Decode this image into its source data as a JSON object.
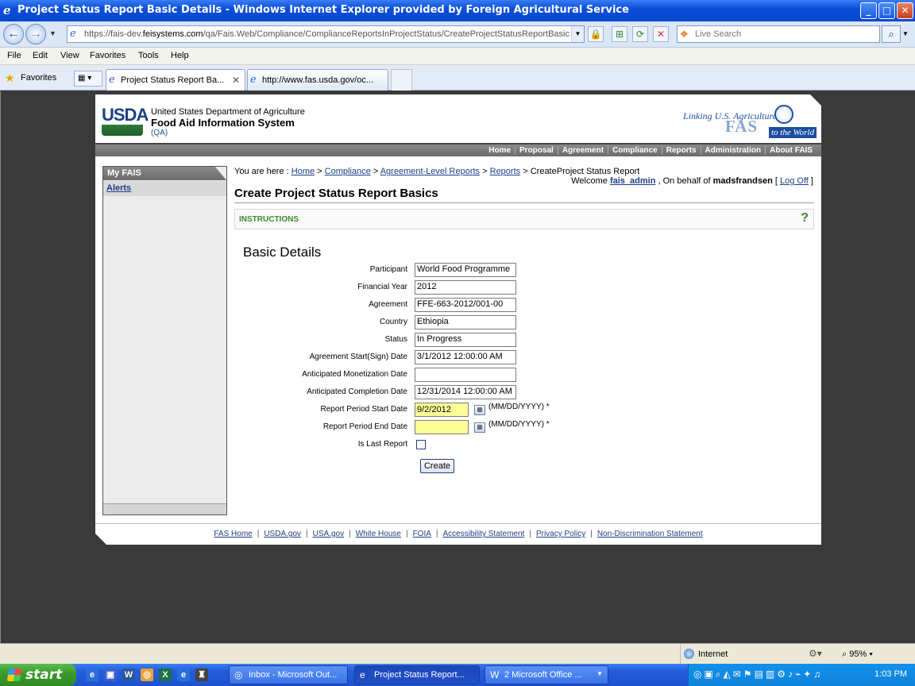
{
  "window": {
    "title": "Project Status Report Basic Details - Windows Internet Explorer provided by Foreign Agricultural Service",
    "minimize": "_",
    "maximize": "□",
    "close": "✕"
  },
  "addressbar": {
    "url_prefix": "https://fais-dev.",
    "url_host": "feisystems.com",
    "url_rest": "/qa/Fais.Web/Compliance/ComplianceReportsInProjectStatus/CreateProjectStatusReportBasic",
    "search_placeholder": "Live Search"
  },
  "menu": {
    "items": [
      "File",
      "Edit",
      "View",
      "Favorites",
      "Tools",
      "Help"
    ]
  },
  "tabs": {
    "favorites": "Favorites",
    "tab1": "Project Status Report Ba...",
    "tab1_close": "✕",
    "tab2": "http://www.fas.usda.gov/oc..."
  },
  "header": {
    "logo": "USDA",
    "dept": "United States Department of Agriculture",
    "system": "Food Aid Information System",
    "env": "(QA)",
    "fas_tagline": "Linking U.S. Agriculture",
    "fas_logo": "FAS",
    "fas_world": "to the World"
  },
  "topnav": [
    "Home",
    "Proposal",
    "Agreement",
    "Compliance",
    "Reports",
    "Administration",
    "About FAIS"
  ],
  "sidebar": {
    "title": "My FAIS",
    "alerts": "Alerts"
  },
  "breadcrumb": {
    "prefix": "You are here :",
    "home": "Home",
    "compliance": "Compliance",
    "agreement_reports": "Agreement-Level Reports",
    "reports": "Reports",
    "current": "CreateProject Status Report",
    "sep": ">"
  },
  "welcome": {
    "text": "Welcome",
    "user": "fais_admin",
    "behalf": ", On behalf of",
    "behalf_user": "madsfrandsen",
    "logoff": "Log Off"
  },
  "page": {
    "title": "Create Project Status Report Basics",
    "instructions": "INSTRUCTIONS",
    "help": "?",
    "section": "Basic Details"
  },
  "form": {
    "participant_label": "Participant",
    "participant": "World Food Programme",
    "fy_label": "Financial Year",
    "fy": "2012",
    "agreement_label": "Agreement",
    "agreement": "FFE-663-2012/001-00",
    "country_label": "Country",
    "country": "Ethiopia",
    "status_label": "Status",
    "status": "In Progress",
    "start_label": "Agreement Start(Sign) Date",
    "start": "3/1/2012 12:00:00 AM",
    "monet_label": "Anticipated Monetization Date",
    "monet": "",
    "completion_label": "Anticipated Completion Date",
    "completion": "12/31/2014 12:00:00 AM",
    "rp_start_label": "Report Period Start Date",
    "rp_start": "9/2/2012",
    "rp_end_label": "Report Period End Date",
    "rp_end": "",
    "date_format": "(MM/DD/YYYY)  *",
    "last_label": "Is Last Report",
    "create": "Create"
  },
  "footer": [
    "FAS Home",
    "USDA.gov",
    "USA.gov",
    "White House",
    "FOIA",
    "Accessibility Statement",
    "Privacy Policy",
    "Non-Discrimination Statement"
  ],
  "statusbar": {
    "zone": "Internet",
    "zoom": "95%"
  },
  "taskbar": {
    "start": "start",
    "task1": "Inbox - Microsoft Out...",
    "task2": "Project Status Report...",
    "task3": "2 Microsoft Office ...",
    "clock": "1:03 PM"
  }
}
